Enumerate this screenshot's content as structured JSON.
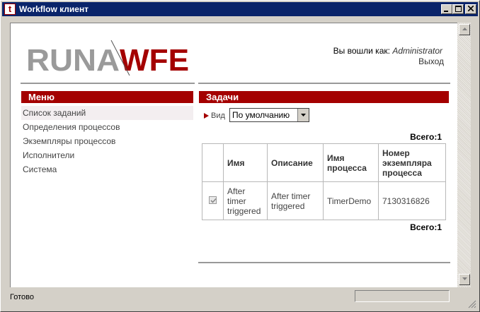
{
  "window": {
    "title": "Workflow клиент",
    "icon": "app-icon",
    "icon_letter": "t",
    "controls": [
      "minimize-icon",
      "maximize-icon",
      "close-icon"
    ]
  },
  "header": {
    "logo_left": "RUNA",
    "logo_right": "WFE",
    "logged_in_label": "Вы вошли как:",
    "username": "Administrator",
    "logout": "Выход"
  },
  "menu": {
    "title": "Меню",
    "items": [
      {
        "label": "Список заданий",
        "active": true
      },
      {
        "label": "Определения процессов"
      },
      {
        "label": "Экземпляры процессов"
      },
      {
        "label": "Исполнители"
      },
      {
        "label": "Система"
      }
    ]
  },
  "tasks": {
    "title": "Задачи",
    "view_label": "Вид",
    "view_selected": "По умолчанию",
    "total_label": "Всего:1",
    "columns": [
      "",
      "Имя",
      "Описание",
      "Имя процесса",
      "Номер экземпляра процесса"
    ],
    "rows": [
      {
        "name": "After timer triggered",
        "description": "After timer triggered",
        "process": "TimerDemo",
        "instance": "7130316826",
        "checked": true
      }
    ]
  },
  "statusbar": {
    "text": "Готово"
  },
  "colors": {
    "titlebar": "#0a246a",
    "accent": "#a40000",
    "logo_gray": "#9a9a9a"
  }
}
